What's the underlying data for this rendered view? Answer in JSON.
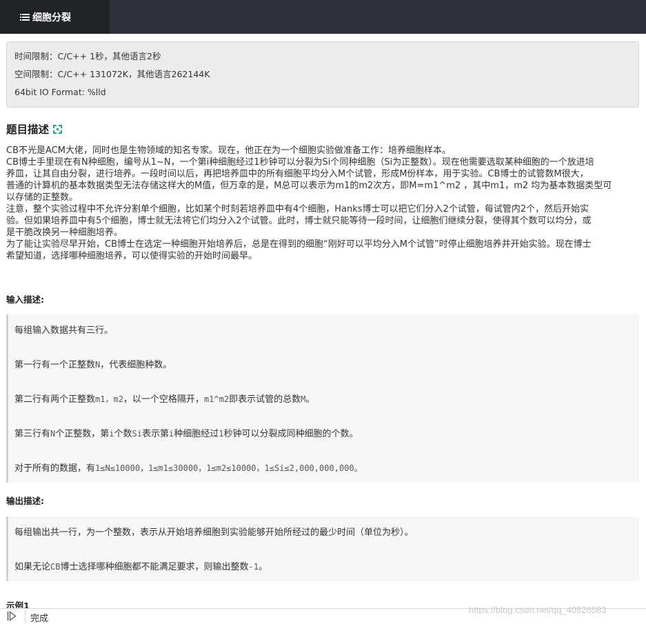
{
  "nav": {
    "active_tab": "细胞分裂"
  },
  "limits": {
    "time": "时间限制：C/C++ 1秒，其他语言2秒",
    "space": "空间限制：C/C++ 131072K，其他语言262144K",
    "format": "64bit IO Format: %lld"
  },
  "problem": {
    "title": "题目描述",
    "lines": [
      "CB不光是ACM大佬，同时也是生物领域的知名专家。现在，他正在为一个细胞实验做准备工作：培养细胞样本。",
      "CB博士手里现在有N种细胞，编号从1~N，一个第i种细胞经过1秒钟可以分裂为Si个同种细胞（Si为正整数）。现在他需要选取某种细胞的一个放进培",
      "养皿，让其自由分裂，进行培养。一段时间以后，再把培养皿中的所有细胞平均分入M个试管，形成M份样本，用于实验。CB博士的试管数M很大，",
      "普通的计算机的基本数据类型无法存储这样大的M值，但万幸的是，M总可以表示为m1的m2次方，即M=m1^m2 ，其中m1，m2 均为基本数据类型可",
      "以存储的正整数。",
      "注意，整个实验过程中不允许分割单个细胞，比如某个时刻若培养皿中有4个细胞，Hanks博士可以把它们分入2个试管，每试管内2个，然后开始实",
      "验。但如果培养皿中有5个细胞，博士就无法将它们均分入2个试管。此时，博士就只能等待一段时间，让细胞们继续分裂，使得其个数可以均分，或",
      "是干脆改换另一种细胞培养。",
      "为了能让实验尽早开始，CB博士在选定一种细胞开始培养后，总是在得到的细胞“刚好可以平均分入M个试管”时停止细胞培养并开始实验。现在博士",
      "希望知道，选择哪种细胞培养，可以使得实验的开始时间最早。"
    ]
  },
  "input": {
    "title": "输入描述:",
    "l1": "每组输入数据共有三行。",
    "l2a": "第一行有一个正整数",
    "l2b": "N",
    "l2c": "，代表细胞种数。",
    "l3a": "第二行有两个正整数",
    "l3b": "m1，m2",
    "l3c": "，以一个空格隔开，",
    "l3d": "m1^m2",
    "l3e": "即表示试管的总数",
    "l3f": "M",
    "l3g": "。",
    "l4a": "第三行有",
    "l4b": "N",
    "l4c": "个正整数，第",
    "l4d": "i",
    "l4e": "个数",
    "l4f": "Si",
    "l4g": "表示第",
    "l4h": "i",
    "l4i": "种细胞经过",
    "l4j": "1",
    "l4k": "秒钟可以分裂成同种细胞的个数。",
    "l5a": "对于所有的数据，有",
    "l5b": "1≤N≤10000，1≤m1≤30000，1≤m2≤10000，1≤Si≤2,000,000,000。"
  },
  "output": {
    "title": "输出描述:",
    "l1": "每组输出共一行，为一个整数，表示从开始培养细胞到实验能够开始所经过的最少时间（单位为秒）。",
    "l2a": "如果无论",
    "l2b": "CB",
    "l2c": "博士选择哪种细胞都不能满足要求，则输出整数",
    "l2d": "-1",
    "l2e": "。"
  },
  "example": {
    "title": "示例1"
  },
  "status": {
    "text": "完成"
  },
  "watermark": "https://blog.csdn.net/qq_40826583"
}
